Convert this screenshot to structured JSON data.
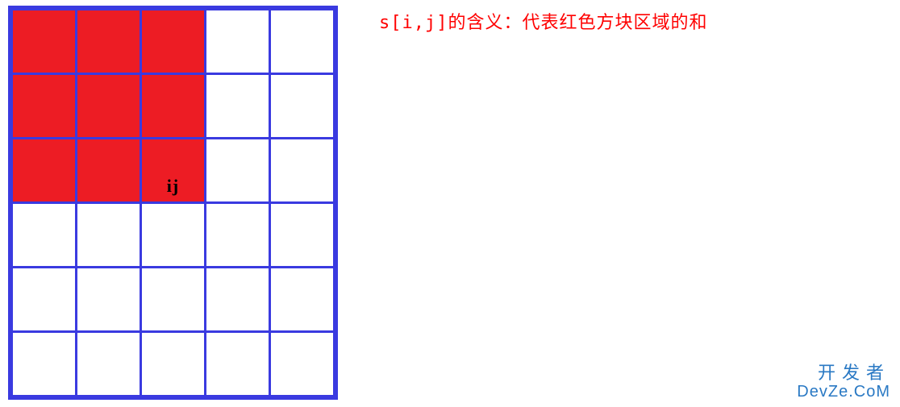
{
  "caption": "s[i,j]的含义：代表红色方块区域的和",
  "grid": {
    "rows": 6,
    "cols": 5,
    "filled_region": {
      "row_end": 3,
      "col_end": 3
    },
    "marker": {
      "row": 3,
      "col": 3,
      "label": "ij"
    },
    "colors": {
      "border": "#3a3ae0",
      "fill": "#ed1c24",
      "empty": "#ffffff"
    }
  },
  "watermark": {
    "line1": "开发者",
    "line2": "DevZe.CoM"
  }
}
